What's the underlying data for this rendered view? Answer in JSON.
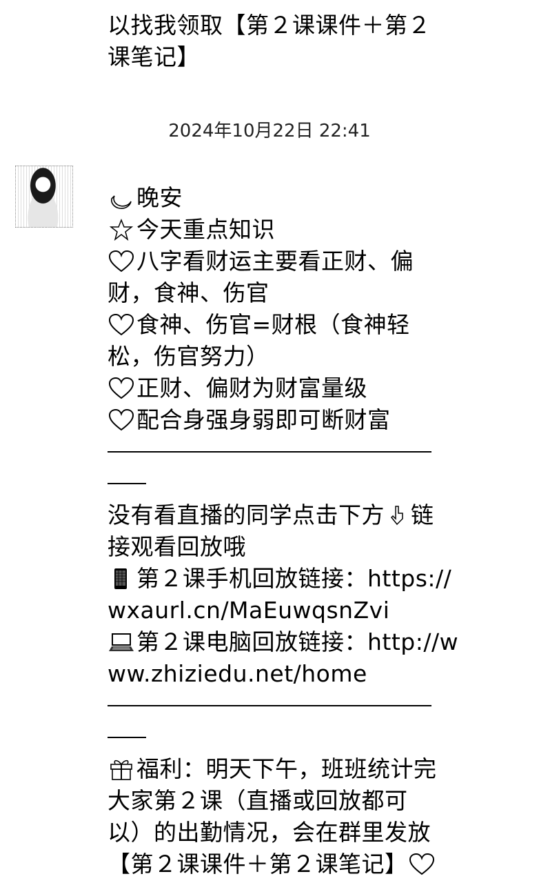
{
  "prev_message": {
    "line1": "以找我领取【第２课课件＋第２",
    "line2": "课笔记】"
  },
  "timestamp": "2024年10月22日 22:41",
  "message": {
    "greeting": "晚安",
    "key_title": "今天重点知识",
    "p1_a": "八字看财运主要看正财、偏",
    "p1_b": "财，食神、伤官",
    "p2_a": "食神、伤官=财根（食神轻",
    "p2_b": "松，伤官努力）",
    "p3": "正财、偏财为财富量级",
    "p4": "配合身强身弱即可断财富",
    "replay_a_pre": "没有看直播的同学点击下方",
    "replay_a_post": "链",
    "replay_b": "接观看回放哦",
    "phone_a": "第２课手机回放链接：https://",
    "phone_b": "wxaurl.cn/MaEuwqsnZvi",
    "pc_a": "第２课电脑回放链接：http://w",
    "pc_b": "ww.zhiziedu.net/home",
    "gift_a": "福利：明天下午，班班统计完",
    "gift_b": "大家第２课（直播或回放都可",
    "gift_c": "以）的出勤情况，会在群里发放",
    "gift_d": "【第２课课件＋第２课笔记】"
  },
  "icons": {
    "moon": "crescent-moon-icon",
    "star": "star-icon",
    "heart": "white-heart-icon",
    "point_down": "pointing-down-icon",
    "phone": "mobile-phone-icon",
    "laptop": "laptop-icon",
    "gift": "gift-icon"
  }
}
